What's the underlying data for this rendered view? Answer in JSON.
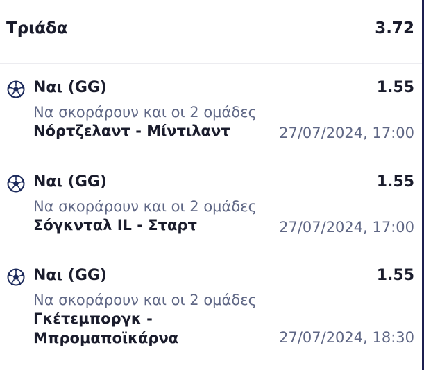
{
  "header": {
    "title": "Τριάδα",
    "odds": "3.72"
  },
  "icons": {
    "sport": "soccer-ball-icon"
  },
  "colors": {
    "text": "#1a1c2c",
    "secondary": "#5f6785",
    "divider": "#ececf0",
    "edge": "#1c1f4f"
  },
  "selections": [
    {
      "pick": "Ναι (GG)",
      "odds": "1.55",
      "market": "Να σκοράρουν και οι 2 ομάδες",
      "match": "Νόρτζελαντ - Μίντιλαντ",
      "datetime": "27/07/2024, 17:00"
    },
    {
      "pick": "Ναι (GG)",
      "odds": "1.55",
      "market": "Να σκοράρουν και οι 2 ομάδες",
      "match": "Σόγκνταλ IL - Σταρτ",
      "datetime": "27/07/2024, 17:00"
    },
    {
      "pick": "Ναι (GG)",
      "odds": "1.55",
      "market": "Να σκοράρουν και οι 2 ομάδες",
      "match": "Γκέτεμποργκ - Μπρομαποϊκάρνα",
      "datetime": "27/07/2024, 18:30"
    }
  ]
}
